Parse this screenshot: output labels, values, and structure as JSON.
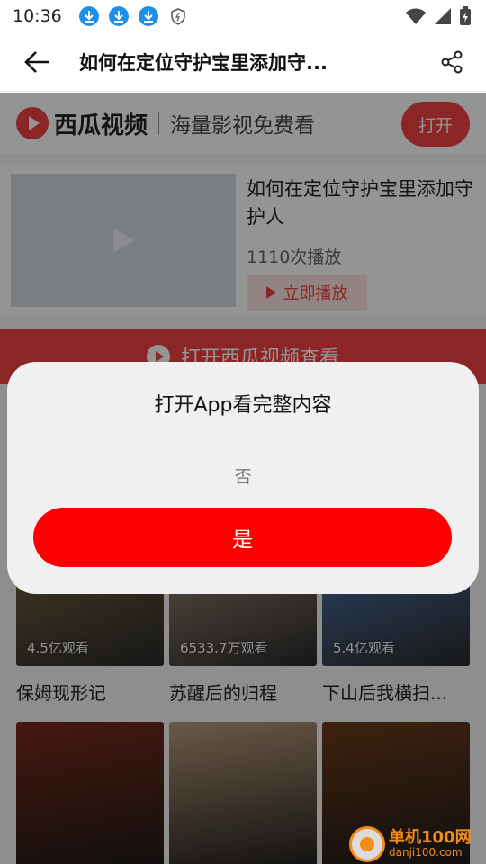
{
  "status_bar": {
    "time": "10:36"
  },
  "header": {
    "title": "如何在定位守护宝里添加守..."
  },
  "brand": {
    "name": "西瓜视频",
    "slogan": "海量影视免费看",
    "open_label": "打开"
  },
  "video": {
    "title": "如何在定位守护宝里添加守护人",
    "plays": "1110次播放",
    "play_now_label": "立即播放"
  },
  "open_xigua_label": "打开西瓜视频查看",
  "grid": [
    {
      "count": "4.5亿观看",
      "title": "保姆现形记",
      "color": "#6a5a3a"
    },
    {
      "count": "6533.7万观看",
      "title": "苏醒后的归程",
      "color": "#8a7a6a"
    },
    {
      "count": "5.4亿观看",
      "title": "下山后我横扫...",
      "color": "#4a6a9a"
    }
  ],
  "grid_row2_colors": [
    "#7a2a1a",
    "#b79a7a",
    "#6a3a1a"
  ],
  "modal": {
    "title": "打开App看完整内容",
    "no_label": "否",
    "yes_label": "是"
  },
  "watermark": {
    "name": "单机100网",
    "url": "danji100.com"
  }
}
